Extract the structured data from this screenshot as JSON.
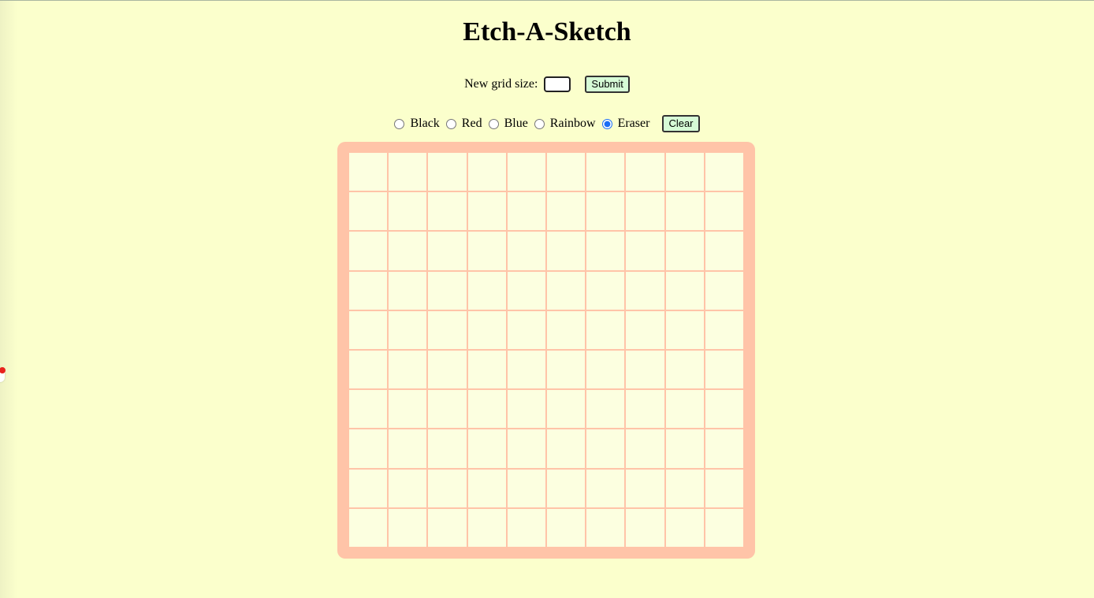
{
  "page": {
    "title": "Etch-A-Sketch",
    "background_color": "#fbffcc"
  },
  "size_control": {
    "label": "New grid size:",
    "input_value": "",
    "input_placeholder": "",
    "submit_label": "Submit"
  },
  "modes": {
    "options": [
      {
        "value": "black",
        "label": "Black",
        "checked": false
      },
      {
        "value": "red",
        "label": "Red",
        "checked": false
      },
      {
        "value": "blue",
        "label": "Blue",
        "checked": false
      },
      {
        "value": "rainbow",
        "label": "Rainbow",
        "checked": false
      },
      {
        "value": "eraser",
        "label": "Eraser",
        "checked": true
      }
    ],
    "selected": "eraser",
    "clear_label": "Clear"
  },
  "grid": {
    "rows": 10,
    "columns": 10,
    "border_color": "#ffc4a8",
    "cell_color": "#fcffe0",
    "filled_cells": []
  },
  "colors": {
    "button_bg": "#d6fbd6",
    "radio_accent": "#1a6ef5"
  }
}
